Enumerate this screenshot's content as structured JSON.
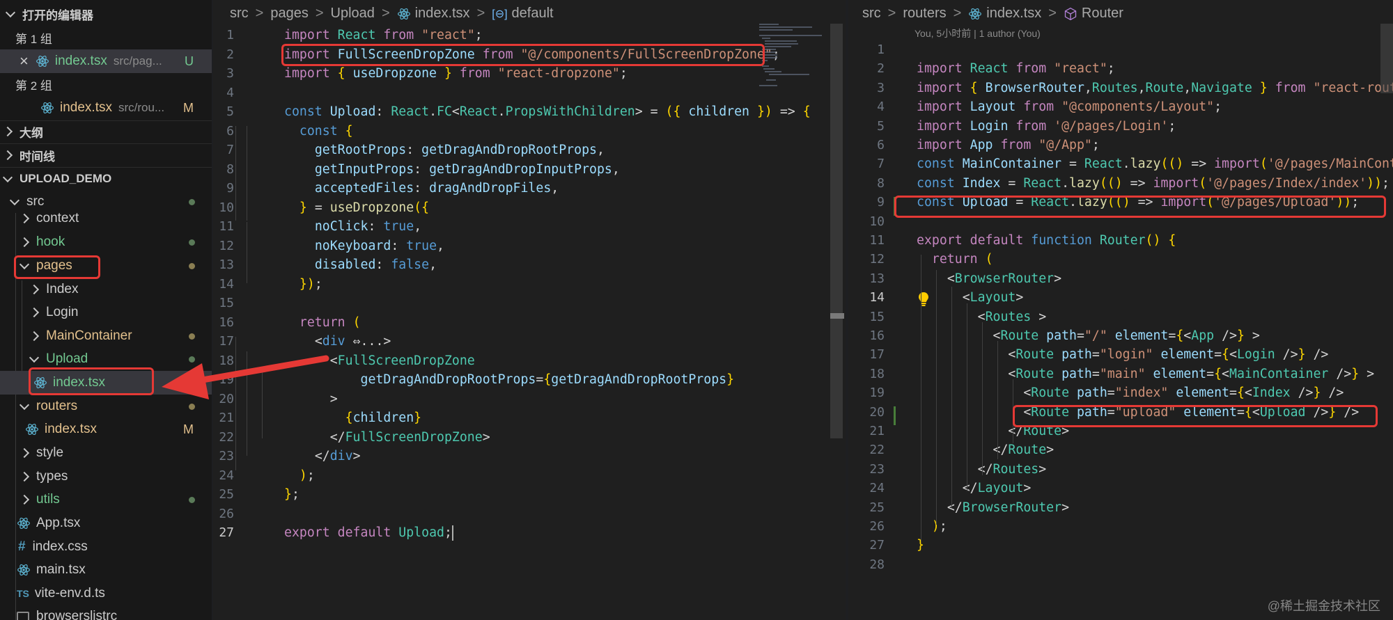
{
  "sidebar": {
    "open_editors_title": "打开的编辑器",
    "group1_label": "第 1 组",
    "group1_file": {
      "name": "index.tsx",
      "desc": "src/pag...",
      "badge": "U"
    },
    "group2_label": "第 2 组",
    "group2_file": {
      "name": "index.tsx",
      "desc": "src/rou...",
      "badge": "M"
    },
    "outline_title": "大纲",
    "timeline_title": "时间线",
    "project_title": "UPLOAD_DEMO",
    "tree": {
      "src": "src",
      "context": "context",
      "hook": "hook",
      "pages": "pages",
      "index_folder": "Index",
      "login_folder": "Login",
      "maincontainer_folder": "MainContainer",
      "upload_folder": "Upload",
      "upload_index": "index.tsx",
      "routers": "routers",
      "routers_index": "index.tsx",
      "routers_index_badge": "M",
      "style": "style",
      "types": "types",
      "utils": "utils",
      "app_tsx": "App.tsx",
      "index_css": "index.css",
      "main_tsx": "main.tsx",
      "vite_env": "vite-env.d.ts",
      "browserslist": "browserslistrc"
    }
  },
  "editor_left": {
    "breadcrumb": [
      "src",
      "pages",
      "Upload",
      "index.tsx",
      "default"
    ],
    "active_line": "27",
    "lines": [
      {
        "n": "1",
        "t": "import React from \"react\";"
      },
      {
        "n": "2",
        "t": "import FullScreenDropZone from \"@/components/FullScreenDropZone\";"
      },
      {
        "n": "3",
        "t": "import { useDropzone } from \"react-dropzone\";"
      },
      {
        "n": "4",
        "t": ""
      },
      {
        "n": "5",
        "t": "const Upload: React.FC<React.PropsWithChildren> = ({ children }) => {"
      },
      {
        "n": "6",
        "t": "  const {"
      },
      {
        "n": "7",
        "t": "    getRootProps: getDragAndDropRootProps,"
      },
      {
        "n": "8",
        "t": "    getInputProps: getDragAndDropInputProps,"
      },
      {
        "n": "9",
        "t": "    acceptedFiles: dragAndDropFiles,"
      },
      {
        "n": "10",
        "t": "  } = useDropzone({"
      },
      {
        "n": "11",
        "t": "    noClick: true,"
      },
      {
        "n": "12",
        "t": "    noKeyboard: true,"
      },
      {
        "n": "13",
        "t": "    disabled: false,"
      },
      {
        "n": "14",
        "t": "  });"
      },
      {
        "n": "15",
        "t": ""
      },
      {
        "n": "16",
        "t": "  return ("
      },
      {
        "n": "17",
        "t": "    <div ⇔...>"
      },
      {
        "n": "18",
        "t": "      <FullScreenDropZone"
      },
      {
        "n": "19",
        "t": "          getDragAndDropRootProps={getDragAndDropRootProps}"
      },
      {
        "n": "20",
        "t": "      >"
      },
      {
        "n": "21",
        "t": "        {children}"
      },
      {
        "n": "22",
        "t": "      </FullScreenDropZone>"
      },
      {
        "n": "23",
        "t": "    </div>"
      },
      {
        "n": "24",
        "t": "  );"
      },
      {
        "n": "25",
        "t": "};"
      },
      {
        "n": "26",
        "t": ""
      },
      {
        "n": "27",
        "t": "export default Upload;"
      }
    ]
  },
  "editor_right": {
    "breadcrumb": [
      "src",
      "routers",
      "index.tsx",
      "Router"
    ],
    "blame": "You, 5小时前 | 1 author (You)",
    "active_line": "14",
    "lines": [
      {
        "n": "1",
        "t": ""
      },
      {
        "n": "2",
        "t": "import React from \"react\";"
      },
      {
        "n": "3",
        "t": "import { BrowserRouter,Routes,Route,Navigate } from \"react-router-dom\";"
      },
      {
        "n": "4",
        "t": "import Layout from \"@components/Layout\";"
      },
      {
        "n": "5",
        "t": "import Login from '@/pages/Login';"
      },
      {
        "n": "6",
        "t": "import App from \"@/App\";"
      },
      {
        "n": "7",
        "t": "const MainContainer = React.lazy(() => import('@/pages/MainContainer'));"
      },
      {
        "n": "8",
        "t": "const Index = React.lazy(() => import('@/pages/Index/index'));"
      },
      {
        "n": "9",
        "t": "const Upload = React.lazy(() => import('@/pages/Upload'));"
      },
      {
        "n": "10",
        "t": ""
      },
      {
        "n": "11",
        "t": "export default function Router() {"
      },
      {
        "n": "12",
        "t": "  return ("
      },
      {
        "n": "13",
        "t": "    <BrowserRouter>"
      },
      {
        "n": "14",
        "t": "      <Layout>"
      },
      {
        "n": "15",
        "t": "        <Routes >"
      },
      {
        "n": "16",
        "t": "          <Route path=\"/\" element={<App />} >"
      },
      {
        "n": "17",
        "t": "            <Route path=\"login\" element={<Login />} />"
      },
      {
        "n": "18",
        "t": "            <Route path=\"main\" element={<MainContainer />} >"
      },
      {
        "n": "19",
        "t": "              <Route path=\"index\" element={<Index />} />"
      },
      {
        "n": "20",
        "t": "              <Route path=\"upload\" element={<Upload />} />"
      },
      {
        "n": "21",
        "t": "            </Route>"
      },
      {
        "n": "22",
        "t": "          </Route>"
      },
      {
        "n": "23",
        "t": "        </Routes>"
      },
      {
        "n": "24",
        "t": "      </Layout>"
      },
      {
        "n": "25",
        "t": "    </BrowserRouter>"
      },
      {
        "n": "26",
        "t": "  );"
      },
      {
        "n": "27",
        "t": "}"
      },
      {
        "n": "28",
        "t": ""
      }
    ]
  },
  "watermark": "@稀土掘金技术社区",
  "colors": {
    "highlight_box": "#e53935",
    "arrow": "#e53935",
    "modified": "#e2c08d"
  }
}
